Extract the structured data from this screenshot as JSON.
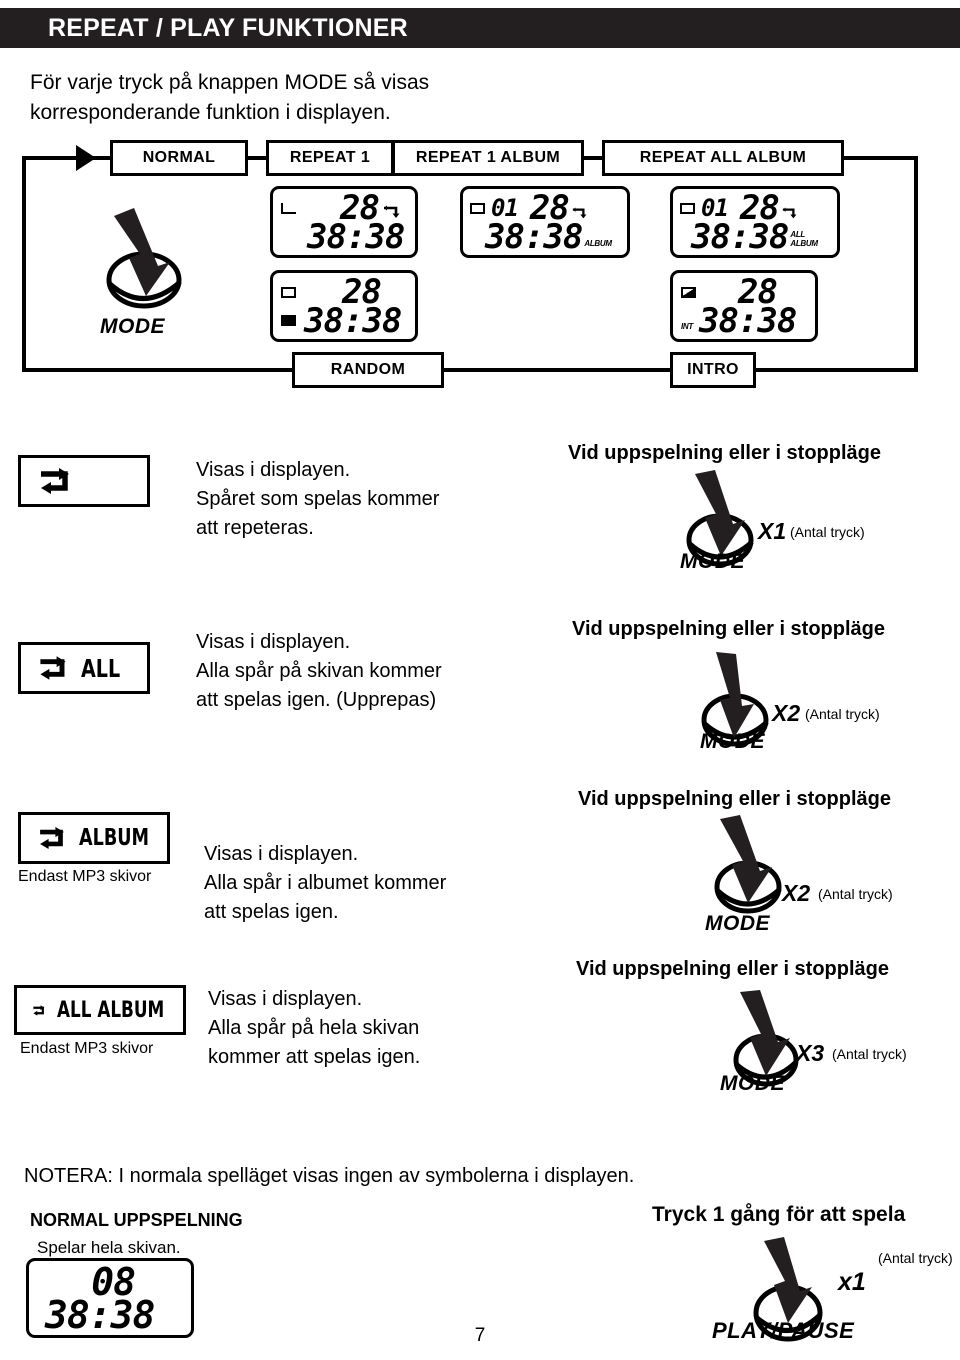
{
  "header": {
    "title": "REPEAT / PLAY FUNKTIONER"
  },
  "intro": {
    "text": "För varje tryck på knappen MODE så visas korresponderande funktion i displayen."
  },
  "diagram": {
    "mode_label": "MODE",
    "boxes": [
      {
        "id": "normal",
        "label": "NORMAL"
      },
      {
        "id": "repeat1",
        "label": "REPEAT 1"
      },
      {
        "id": "repeat1album",
        "label": "REPEAT 1 ALBUM"
      },
      {
        "id": "repeatallalbum",
        "label": "REPEAT ALL ALBUM"
      },
      {
        "id": "random",
        "label": "RANDOM"
      },
      {
        "id": "intro",
        "label": "INTRO"
      }
    ],
    "displays": [
      {
        "id": "repeat1-top",
        "track": "28",
        "time": "38:38",
        "disc": "",
        "marker": "corner",
        "repeat_icon": "repeat-one",
        "tags": []
      },
      {
        "id": "random-lcd",
        "track": "28",
        "time": "38:38",
        "disc": "",
        "marker": "box",
        "repeat_icon": "",
        "tags": []
      },
      {
        "id": "repeat1album-top",
        "track": "28",
        "time": "38:38",
        "disc": "01",
        "marker": "box",
        "repeat_icon": "repeat-one",
        "tags": [
          "ALBUM"
        ]
      },
      {
        "id": "repeatallalbum-top",
        "track": "28",
        "time": "38:38",
        "disc": "01",
        "marker": "box",
        "repeat_icon": "repeat-one",
        "tags": [
          "ALL",
          "ALBUM"
        ]
      },
      {
        "id": "intro-lcd",
        "track": "28",
        "time": "38:38",
        "disc": "",
        "marker": "half",
        "repeat_icon": "",
        "tags": [
          "INT"
        ]
      }
    ]
  },
  "rows": [
    {
      "id": "repeat-one",
      "symbol_text": "",
      "mp3_note": "",
      "description": "Visas i displayen.\nSpåret som spelas kommer\natt repeteras.",
      "heading": "Vid uppspelning eller i stoppläge",
      "press_count": "X1",
      "press_note": "(Antal tryck)",
      "button_label": "MODE"
    },
    {
      "id": "repeat-all",
      "symbol_text": "ALL",
      "mp3_note": "",
      "description": "Visas i displayen.\nAlla spår på skivan kommer\natt spelas igen. (Upprepas)",
      "heading": "Vid uppspelning eller i stoppläge",
      "press_count": "X2",
      "press_note": "(Antal tryck)",
      "button_label": "MODE"
    },
    {
      "id": "repeat-album",
      "symbol_text": "ALBUM",
      "mp3_note": "Endast MP3 skivor",
      "description": "Visas i displayen.\nAlla spår i albumet kommer\natt spelas igen.",
      "heading": "Vid uppspelning eller i stoppläge",
      "press_count": "X2",
      "press_note": "(Antal tryck)",
      "button_label": "MODE"
    },
    {
      "id": "repeat-all-album",
      "symbol_text": "ALL ALBUM",
      "mp3_note": "Endast MP3 skivor",
      "description": "Visas i displayen.\nAlla spår på hela skivan\nkommer att spelas igen.",
      "heading": "Vid uppspelning eller i stoppläge",
      "press_count": "X3",
      "press_note": "(Antal tryck)",
      "button_label": "MODE"
    }
  ],
  "footer": {
    "note": "NOTERA: I normala spelläget visas ingen av symbolerna i displayen.",
    "normal_heading": "NORMAL UPPSPELNING",
    "normal_sub": "Spelar hela skivan.",
    "normal_display": {
      "track": "08",
      "time": "38:38"
    },
    "play_heading": "Tryck 1 gång för att spela",
    "play_count": "x1",
    "play_note": "(Antal tryck)",
    "play_button_label": "PLAY/PAUSE",
    "page_number": "7"
  }
}
